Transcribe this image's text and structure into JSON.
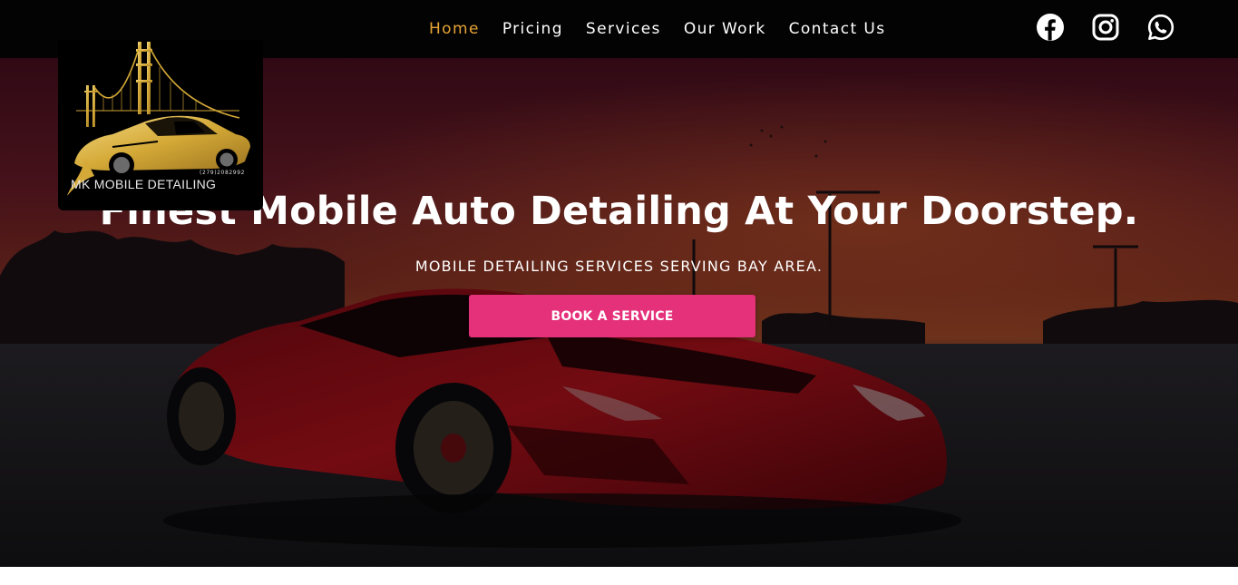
{
  "nav": {
    "items": [
      {
        "label": "Home",
        "active": true
      },
      {
        "label": "Pricing",
        "active": false
      },
      {
        "label": "Services",
        "active": false
      },
      {
        "label": "Our Work",
        "active": false
      },
      {
        "label": "Contact Us",
        "active": false
      }
    ],
    "active_color": "#e7a436"
  },
  "social": {
    "icons": [
      "facebook-icon",
      "instagram-icon",
      "whatsapp-icon"
    ]
  },
  "logo": {
    "phone": "(279)2082992",
    "name": "MK MOBILE DETAILING",
    "colors": {
      "gold": "#d4a937",
      "background": "#000000"
    }
  },
  "hero": {
    "headline": "Finest Mobile Auto Detailing At Your Doorstep.",
    "subheadline": "MOBILE DETAILING SERVICES SERVING BAY AREA.",
    "cta_label": "BOOK A SERVICE",
    "cta_color": "#e5307a"
  }
}
